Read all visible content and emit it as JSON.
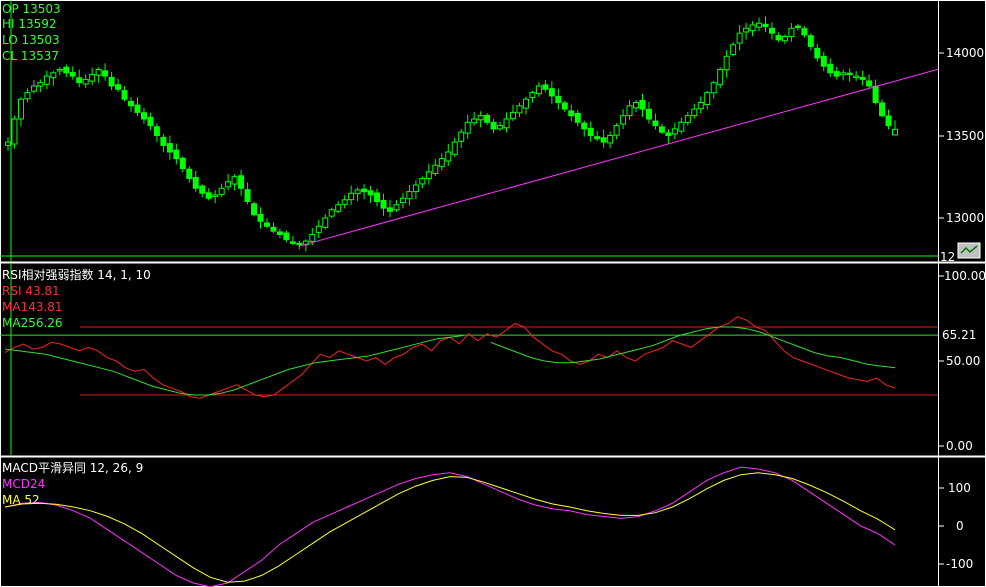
{
  "colors": {
    "background": "#000000",
    "candle": "#00ff00",
    "trendline": "#ff33ff",
    "panel_border": "#ffffff",
    "rsi": "#ff2020",
    "rsi_ma2": "#33dd33",
    "level_line": "#cc2020",
    "level_line_green": "#33dd33",
    "macd": "#ff33ff",
    "macd_ma": "#ffff33"
  },
  "price_panel": {
    "info": {
      "op": "OP 13503",
      "hi": "HI  13592",
      "lo": "LO  13503",
      "cl": "CL  13537"
    },
    "axis_labels": [
      "14000",
      "13500",
      "13000"
    ],
    "bottom_label": "12",
    "corner_icon": "chart-options-icon"
  },
  "rsi_panel": {
    "title": "RSI相对强弱指数 14, 1, 10",
    "legend": {
      "rsi": "RSI  43.81",
      "ma1": "MA143.81",
      "ma2": "MA256.26"
    },
    "axis_labels": [
      "100.00",
      "50.00",
      "0.00"
    ],
    "level_readout": "65.21"
  },
  "macd_panel": {
    "title": "MACD平滑异同 12, 26, 9",
    "legend": {
      "macd": "MCD24",
      "ma": "MA  52"
    },
    "axis_labels": [
      "100",
      "0",
      "-100"
    ]
  },
  "chart_data": [
    {
      "type": "candlestick",
      "ylim": [
        12800,
        14300
      ],
      "yticks": [
        13000,
        13500,
        14000
      ],
      "last_bar": {
        "open": 13503,
        "high": 13592,
        "low": 13503,
        "close": 13537
      },
      "close": [
        13460,
        13600,
        13720,
        13760,
        13800,
        13820,
        13860,
        13880,
        13900,
        13880,
        13860,
        13820,
        13840,
        13870,
        13900,
        13860,
        13800,
        13780,
        13720,
        13680,
        13640,
        13600,
        13560,
        13500,
        13440,
        13400,
        13360,
        13300,
        13240,
        13180,
        13150,
        13120,
        13140,
        13180,
        13220,
        13250,
        13180,
        13100,
        13020,
        12980,
        12950,
        12920,
        12900,
        12870,
        12850,
        12840,
        12860,
        12900,
        12950,
        13000,
        13050,
        13080,
        13110,
        13150,
        13170,
        13160,
        13140,
        13100,
        13060,
        13040,
        13080,
        13120,
        13160,
        13200,
        13240,
        13280,
        13320,
        13360,
        13400,
        13460,
        13520,
        13580,
        13600,
        13620,
        13580,
        13540,
        13560,
        13600,
        13640,
        13680,
        13720,
        13760,
        13800,
        13780,
        13740,
        13700,
        13660,
        13620,
        13580,
        13540,
        13500,
        13480,
        13460,
        13500,
        13560,
        13620,
        13680,
        13700,
        13660,
        13600,
        13560,
        13520,
        13500,
        13540,
        13580,
        13620,
        13660,
        13700,
        13760,
        13820,
        13900,
        13980,
        14050,
        14120,
        14150,
        14170,
        14180,
        14160,
        14120,
        14080,
        14100,
        14150,
        14160,
        14110,
        14040,
        13970,
        13920,
        13880,
        13860,
        13880,
        13870,
        13860,
        13840,
        13800,
        13700,
        13620,
        13560,
        13537
      ],
      "trendline": {
        "from": {
          "bar": 45,
          "value": 12830
        },
        "to": {
          "bar": 138,
          "value": 13840
        }
      }
    },
    {
      "type": "line",
      "title": "RSI相对强弱指数 14, 1, 10",
      "ylim": [
        0,
        100
      ],
      "yticks": [
        0,
        50,
        100
      ],
      "levels": [
        30,
        65.21,
        70
      ],
      "series": [
        {
          "name": "RSI",
          "values": [
            55,
            58,
            60,
            57,
            58,
            61,
            60,
            58,
            56,
            58,
            56,
            52,
            50,
            46,
            44,
            45,
            40,
            36,
            34,
            32,
            29,
            28,
            30,
            32,
            34,
            36,
            33,
            30,
            29,
            30,
            34,
            38,
            42,
            48,
            54,
            52,
            56,
            54,
            52,
            50,
            52,
            48,
            52,
            54,
            58,
            60,
            56,
            62,
            64,
            60,
            66,
            62,
            66,
            64,
            68,
            72,
            70,
            64,
            60,
            56,
            54,
            50,
            48,
            50,
            54,
            52,
            56,
            52,
            50,
            54,
            56,
            58,
            62,
            60,
            58,
            62,
            66,
            70,
            72,
            76,
            74,
            70,
            68,
            62,
            56,
            52,
            50,
            48,
            46,
            44,
            42,
            40,
            39,
            38,
            40,
            36,
            34
          ]
        },
        {
          "name": "MA2",
          "values": [
            57,
            56,
            55,
            54,
            52,
            50,
            48,
            46,
            44,
            41,
            38,
            35,
            33,
            31,
            30,
            30,
            31,
            33,
            36,
            39,
            42,
            45,
            47,
            49,
            50,
            51,
            52,
            53,
            55,
            57,
            59,
            61,
            63,
            64,
            65,
            null,
            61,
            58,
            55,
            52,
            50,
            49,
            49,
            50,
            51,
            53,
            55,
            57,
            59,
            62,
            65,
            67,
            69,
            70,
            70,
            69,
            67,
            64,
            61,
            58,
            55,
            53,
            52,
            50,
            48,
            47,
            46
          ]
        }
      ]
    },
    {
      "type": "line",
      "title": "MACD平滑异同 12, 26, 9",
      "ylim": [
        -170,
        170
      ],
      "yticks": [
        -100,
        0,
        100
      ],
      "series": [
        {
          "name": "MCD",
          "values": [
            50,
            60,
            62,
            55,
            40,
            20,
            -10,
            -40,
            -70,
            -100,
            -130,
            -150,
            -160,
            -150,
            -120,
            -90,
            -50,
            -20,
            10,
            30,
            50,
            70,
            90,
            110,
            125,
            135,
            140,
            130,
            110,
            90,
            70,
            55,
            45,
            40,
            30,
            25,
            20,
            25,
            40,
            60,
            90,
            120,
            140,
            155,
            150,
            140,
            120,
            90,
            60,
            30,
            0,
            -20,
            -50
          ]
        },
        {
          "name": "MA",
          "values": [
            50,
            58,
            60,
            57,
            50,
            40,
            25,
            5,
            -20,
            -50,
            -80,
            -110,
            -135,
            -148,
            -145,
            -130,
            -105,
            -75,
            -45,
            -15,
            10,
            35,
            60,
            85,
            105,
            120,
            130,
            128,
            115,
            100,
            85,
            70,
            58,
            50,
            40,
            33,
            28,
            28,
            35,
            50,
            72,
            98,
            120,
            135,
            140,
            135,
            125,
            108,
            88,
            65,
            40,
            18,
            -10
          ]
        }
      ]
    }
  ]
}
